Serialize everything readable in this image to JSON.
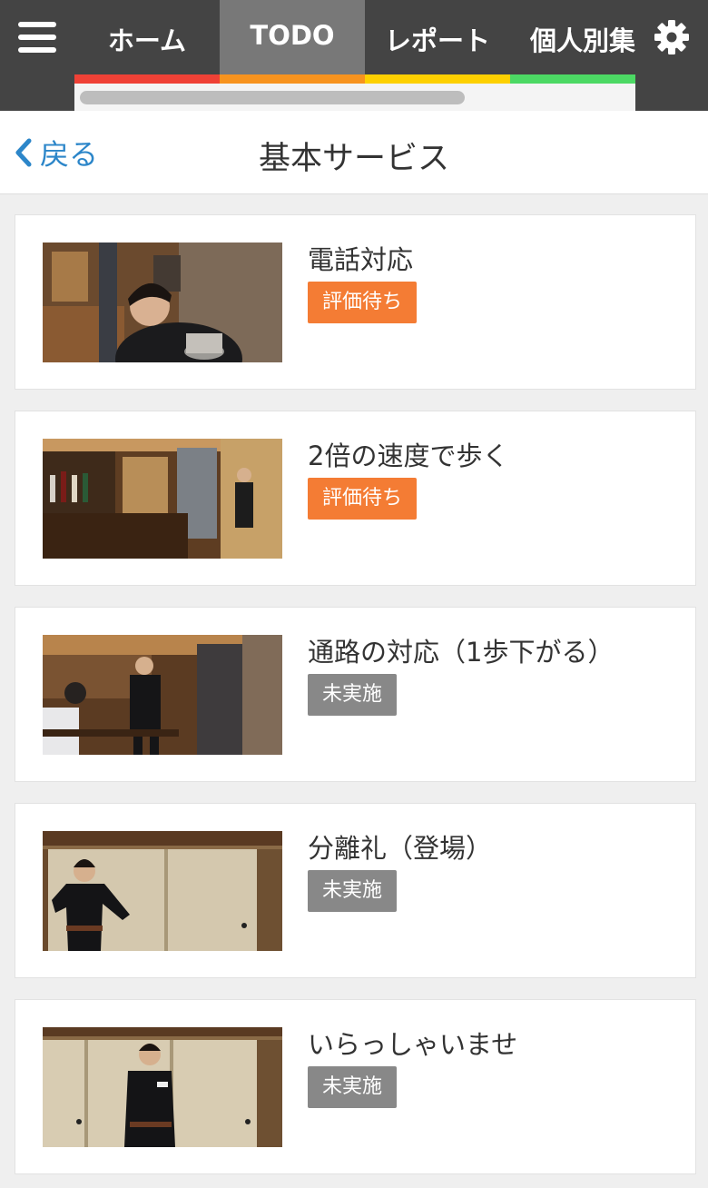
{
  "nav": {
    "menu_icon": "hamburger-menu-icon",
    "settings_icon": "gear-icon",
    "tabs": [
      {
        "label": "ホーム",
        "color": "#ef4136",
        "active": false
      },
      {
        "label": "TODO",
        "color": "#f7931e",
        "active": true
      },
      {
        "label": "レポート",
        "color": "#fdd000",
        "active": false
      },
      {
        "label": "個人別集計",
        "color": "#4cd964",
        "active": false
      }
    ]
  },
  "header": {
    "back_label": "戻る",
    "back_icon": "chevron-left-icon",
    "title": "基本サービス"
  },
  "items": [
    {
      "title": "電話対応",
      "status": "評価待ち",
      "status_color": "#f47c34"
    },
    {
      "title": "2倍の速度で歩く",
      "status": "評価待ち",
      "status_color": "#f47c34"
    },
    {
      "title": "通路の対応（1歩下がる）",
      "status": "未実施",
      "status_color": "#888888"
    },
    {
      "title": "分離礼（登場）",
      "status": "未実施",
      "status_color": "#888888"
    },
    {
      "title": "いらっしゃいませ",
      "status": "未実施",
      "status_color": "#888888"
    }
  ],
  "colors": {
    "accent_link": "#2c86c9",
    "nav_bg": "#444444",
    "nav_active": "#787878"
  }
}
